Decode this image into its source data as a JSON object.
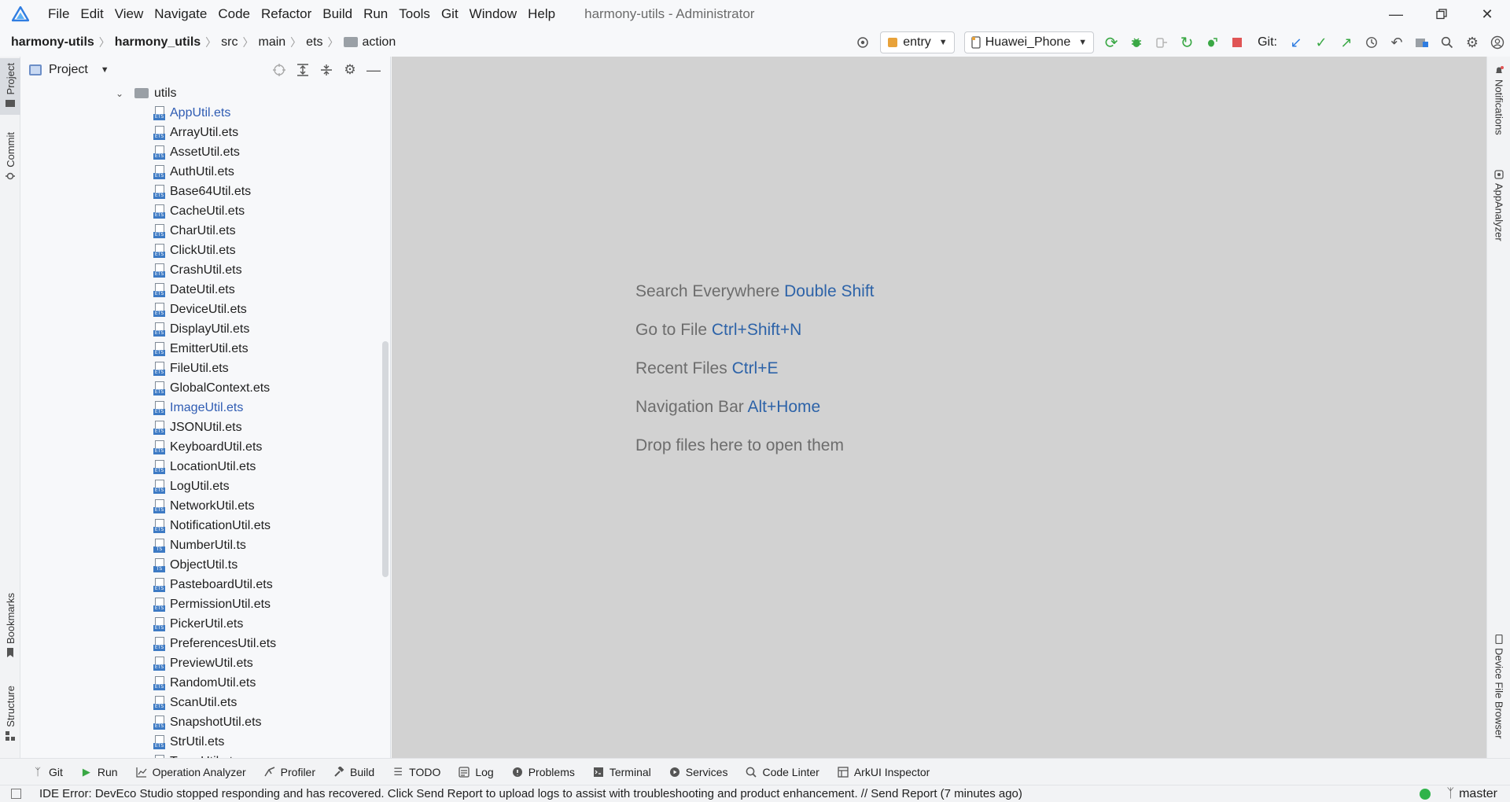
{
  "menu": {
    "items": [
      "File",
      "Edit",
      "View",
      "Navigate",
      "Code",
      "Refactor",
      "Build",
      "Run",
      "Tools",
      "Git",
      "Window",
      "Help"
    ],
    "window_title": "harmony-utils - Administrator"
  },
  "breadcrumb": {
    "project": "harmony-utils",
    "module": "harmony_utils",
    "segments": [
      "src",
      "main",
      "ets"
    ],
    "current": "action"
  },
  "toolbar": {
    "module_select": "entry",
    "device_select": "Huawei_Phone",
    "git_label": "Git:"
  },
  "left_tabs": {
    "project": "Project",
    "commit": "Commit",
    "bookmarks": "Bookmarks",
    "structure": "Structure"
  },
  "project_panel": {
    "title": "Project",
    "folder": "utils",
    "files": [
      {
        "name": "AppUtil.ets",
        "type": "ETS"
      },
      {
        "name": "ArrayUtil.ets",
        "type": "ETS"
      },
      {
        "name": "AssetUtil.ets",
        "type": "ETS"
      },
      {
        "name": "AuthUtil.ets",
        "type": "ETS"
      },
      {
        "name": "Base64Util.ets",
        "type": "ETS"
      },
      {
        "name": "CacheUtil.ets",
        "type": "ETS"
      },
      {
        "name": "CharUtil.ets",
        "type": "ETS"
      },
      {
        "name": "ClickUtil.ets",
        "type": "ETS"
      },
      {
        "name": "CrashUtil.ets",
        "type": "ETS"
      },
      {
        "name": "DateUtil.ets",
        "type": "ETS"
      },
      {
        "name": "DeviceUtil.ets",
        "type": "ETS"
      },
      {
        "name": "DisplayUtil.ets",
        "type": "ETS"
      },
      {
        "name": "EmitterUtil.ets",
        "type": "ETS"
      },
      {
        "name": "FileUtil.ets",
        "type": "ETS"
      },
      {
        "name": "GlobalContext.ets",
        "type": "ETS"
      },
      {
        "name": "ImageUtil.ets",
        "type": "ETS"
      },
      {
        "name": "JSONUtil.ets",
        "type": "ETS"
      },
      {
        "name": "KeyboardUtil.ets",
        "type": "ETS"
      },
      {
        "name": "LocationUtil.ets",
        "type": "ETS"
      },
      {
        "name": "LogUtil.ets",
        "type": "ETS"
      },
      {
        "name": "NetworkUtil.ets",
        "type": "ETS"
      },
      {
        "name": "NotificationUtil.ets",
        "type": "ETS"
      },
      {
        "name": "NumberUtil.ts",
        "type": "TS"
      },
      {
        "name": "ObjectUtil.ts",
        "type": "TS"
      },
      {
        "name": "PasteboardUtil.ets",
        "type": "ETS"
      },
      {
        "name": "PermissionUtil.ets",
        "type": "ETS"
      },
      {
        "name": "PickerUtil.ets",
        "type": "ETS"
      },
      {
        "name": "PreferencesUtil.ets",
        "type": "ETS"
      },
      {
        "name": "PreviewUtil.ets",
        "type": "ETS"
      },
      {
        "name": "RandomUtil.ets",
        "type": "ETS"
      },
      {
        "name": "ScanUtil.ets",
        "type": "ETS"
      },
      {
        "name": "SnapshotUtil.ets",
        "type": "ETS"
      },
      {
        "name": "StrUtil.ets",
        "type": "ETS"
      },
      {
        "name": "TempUtil.ets",
        "type": "ETS"
      }
    ],
    "highlighted_files": [
      "AppUtil.ets",
      "ImageUtil.ets"
    ],
    "highlight_color": "#2f5cb3"
  },
  "editor_hints": [
    {
      "label": "Search Everywhere",
      "key": "Double Shift"
    },
    {
      "label": "Go to File",
      "key": "Ctrl+Shift+N"
    },
    {
      "label": "Recent Files",
      "key": "Ctrl+E"
    },
    {
      "label": "Navigation Bar",
      "key": "Alt+Home"
    },
    {
      "label": "Drop files here to open them",
      "key": ""
    }
  ],
  "right_tabs": {
    "notifications": "Notifications",
    "app_analyzer": "AppAnalyzer",
    "device_file_browser": "Device File Browser"
  },
  "tool_windows": [
    {
      "label": "Git",
      "icon": "git-branch-icon"
    },
    {
      "label": "Run",
      "icon": "run-icon"
    },
    {
      "label": "Operation Analyzer",
      "icon": "chart-icon"
    },
    {
      "label": "Profiler",
      "icon": "profiler-icon"
    },
    {
      "label": "Build",
      "icon": "hammer-icon"
    },
    {
      "label": "TODO",
      "icon": "list-icon"
    },
    {
      "label": "Log",
      "icon": "log-icon"
    },
    {
      "label": "Problems",
      "icon": "info-icon"
    },
    {
      "label": "Terminal",
      "icon": "terminal-icon"
    },
    {
      "label": "Services",
      "icon": "services-icon"
    },
    {
      "label": "Code Linter",
      "icon": "linter-icon"
    },
    {
      "label": "ArkUI Inspector",
      "icon": "inspector-icon"
    }
  ],
  "status": {
    "message": "IDE Error: DevEco Studio stopped responding and has recovered. Click Send Report to upload logs to assist with troubleshooting and product enhancement. // Send Report (7 minutes ago)",
    "branch": "master",
    "ok_color": "#2fb34a"
  },
  "colors": {
    "accent_blue": "#2d63a8",
    "run_green": "#3aa845",
    "stop_red": "#e05555"
  }
}
